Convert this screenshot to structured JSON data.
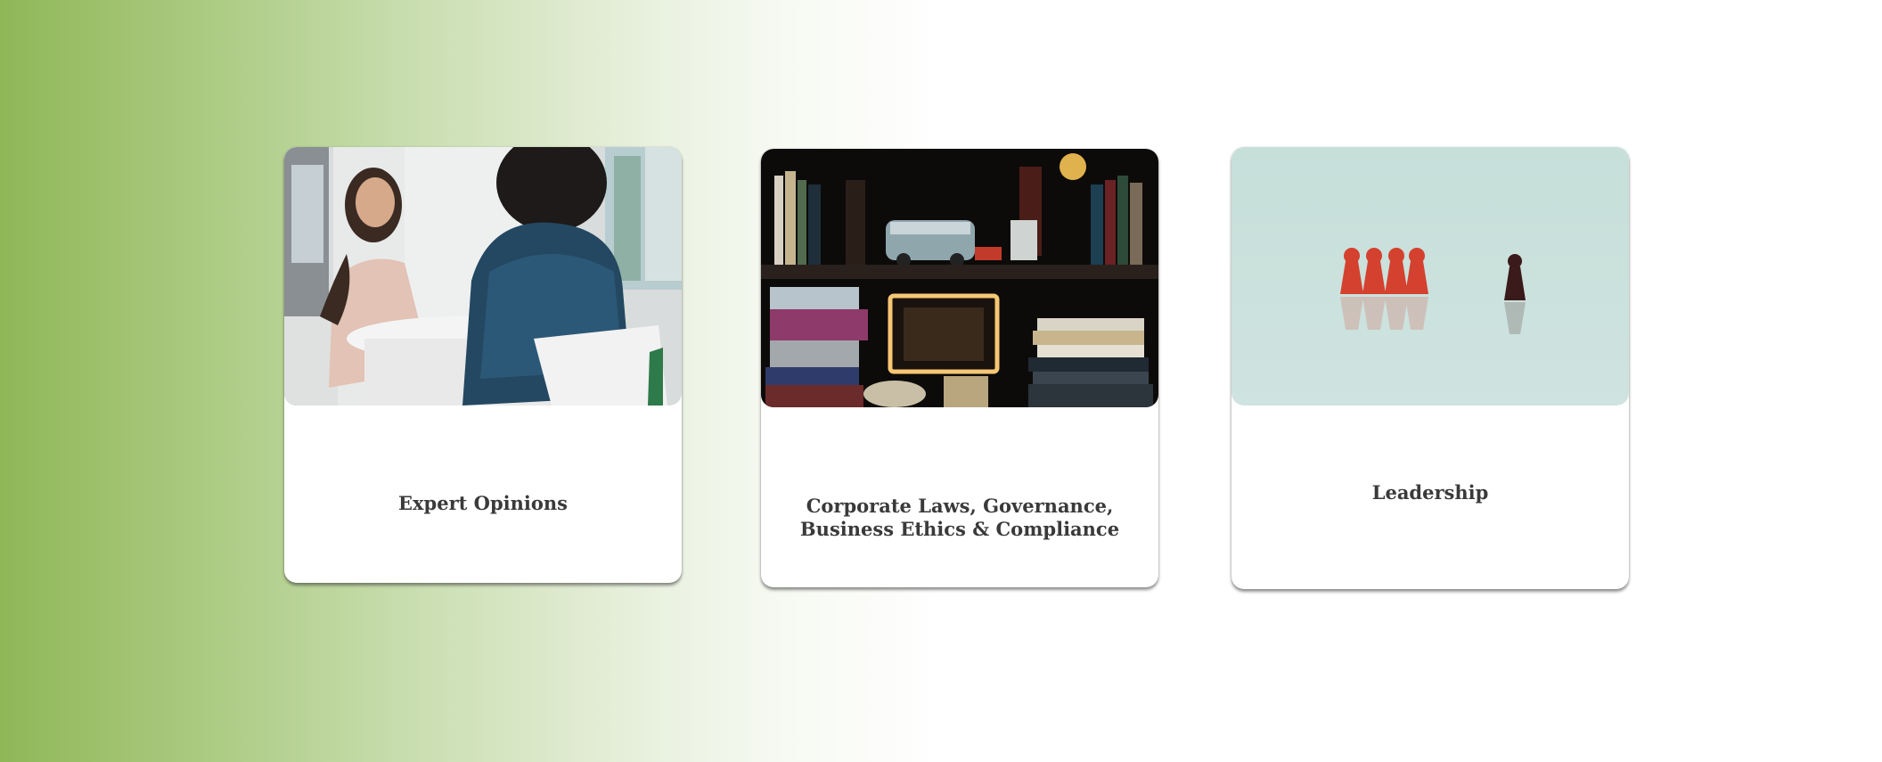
{
  "cards": [
    {
      "title": "Expert Opinions",
      "image": "interview-photo"
    },
    {
      "title": "Corporate Laws, Governance,\nBusiness Ethics & Compliance",
      "image": "bookshelf-photo"
    },
    {
      "title": "Leadership",
      "image": "pawns-photo"
    }
  ],
  "colors": {
    "gradient_start": "#8fb757",
    "background": "#ffffff",
    "caption_text": "#3a3a3a"
  }
}
